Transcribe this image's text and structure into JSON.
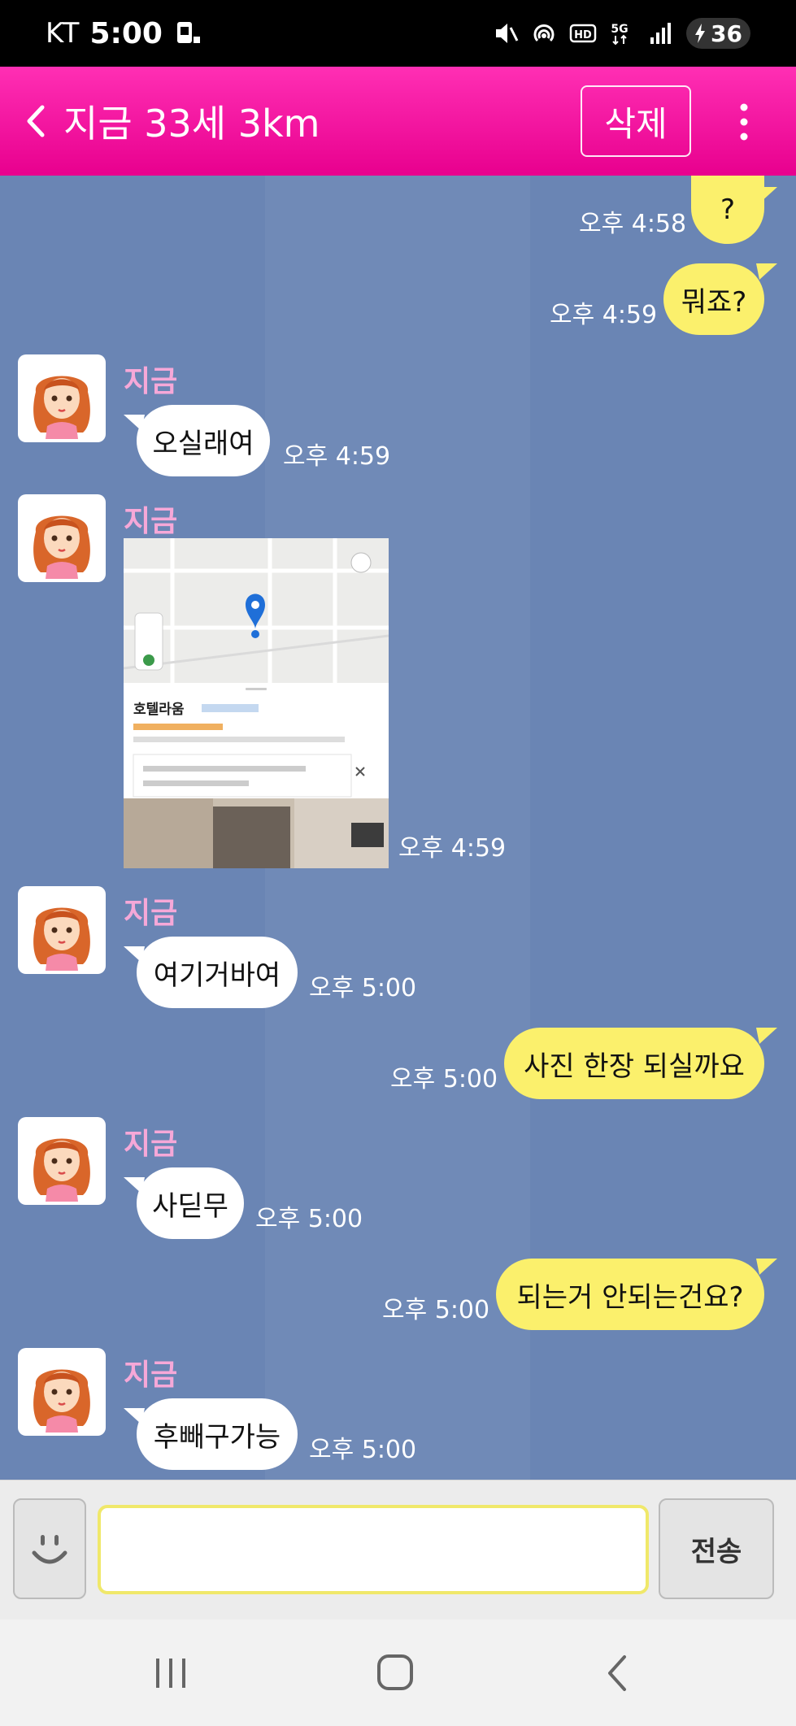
{
  "status_bar": {
    "carrier": "KT",
    "time": "5:00",
    "battery": "36"
  },
  "header": {
    "title": "지금 33세 3km",
    "delete_label": "삭제"
  },
  "messages": [
    {
      "from": "me",
      "text": "?",
      "time": "오후 4:58"
    },
    {
      "from": "me",
      "text": "뭐죠?",
      "time": "오후 4:59"
    },
    {
      "from": "them",
      "sender": "지금",
      "text": "오실래여",
      "time": "오후 4:59"
    },
    {
      "from": "them",
      "sender": "지금",
      "type": "image",
      "image_text": "호텔라움",
      "time": "오후 4:59"
    },
    {
      "from": "them",
      "sender": "지금",
      "text": "여기거바여",
      "time": "오후 5:00"
    },
    {
      "from": "me",
      "text": "사진 한장 되실까요",
      "time": "오후 5:00"
    },
    {
      "from": "them",
      "sender": "지금",
      "text": "사딛무",
      "time": "오후 5:00"
    },
    {
      "from": "me",
      "text": "되는거 안되는건요?",
      "time": "오후 5:00"
    },
    {
      "from": "them",
      "sender": "지금",
      "text": "후빼구가능",
      "time": "오후 5:00"
    }
  ],
  "input": {
    "value": "",
    "send_label": "전송"
  },
  "colors": {
    "header": "#ff2fb4",
    "chat_bg": "#6a85b4",
    "my_bubble": "#fbf06c",
    "their_bubble": "#ffffff",
    "sender_name": "#f6a8d8"
  }
}
